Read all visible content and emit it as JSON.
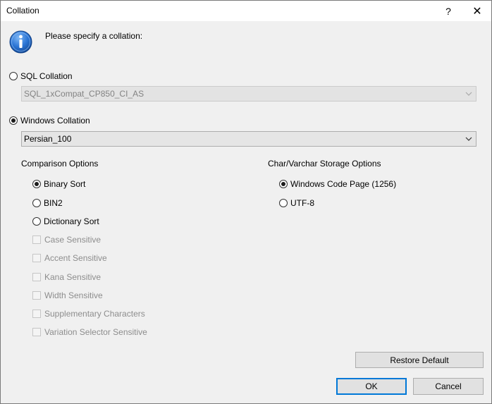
{
  "window": {
    "title": "Collation",
    "help_label": "?",
    "close_label": "✕"
  },
  "prompt": "Please specify a collation:",
  "sql_collation": {
    "label": "SQL Collation",
    "selected": false,
    "value": "SQL_1xCompat_CP850_CI_AS",
    "enabled": false
  },
  "windows_collation": {
    "label": "Windows Collation",
    "selected": true,
    "value": "Persian_100",
    "enabled": true
  },
  "comparison_options": {
    "heading": "Comparison Options",
    "radios": [
      {
        "label": "Binary Sort",
        "selected": true
      },
      {
        "label": "BIN2",
        "selected": false
      },
      {
        "label": "Dictionary Sort",
        "selected": false
      }
    ],
    "checkboxes": [
      {
        "label": "Case Sensitive",
        "checked": false,
        "enabled": false
      },
      {
        "label": "Accent Sensitive",
        "checked": false,
        "enabled": false
      },
      {
        "label": "Kana Sensitive",
        "checked": false,
        "enabled": false
      },
      {
        "label": "Width Sensitive",
        "checked": false,
        "enabled": false
      },
      {
        "label": "Supplementary Characters",
        "checked": false,
        "enabled": false
      },
      {
        "label": "Variation Selector Sensitive",
        "checked": false,
        "enabled": false
      }
    ]
  },
  "storage_options": {
    "heading": "Char/Varchar Storage Options",
    "radios": [
      {
        "label": "Windows Code Page (1256)",
        "selected": true
      },
      {
        "label": "UTF-8",
        "selected": false
      }
    ]
  },
  "buttons": {
    "restore_default": "Restore Default",
    "ok": "OK",
    "cancel": "Cancel"
  },
  "colors": {
    "dialog_background": "#f0f0f0",
    "default_button_border": "#0078d7",
    "info_icon_blue": "#1f6fd1"
  },
  "icons": {
    "info": "info-icon",
    "dropdown": "chevron-down-icon"
  }
}
